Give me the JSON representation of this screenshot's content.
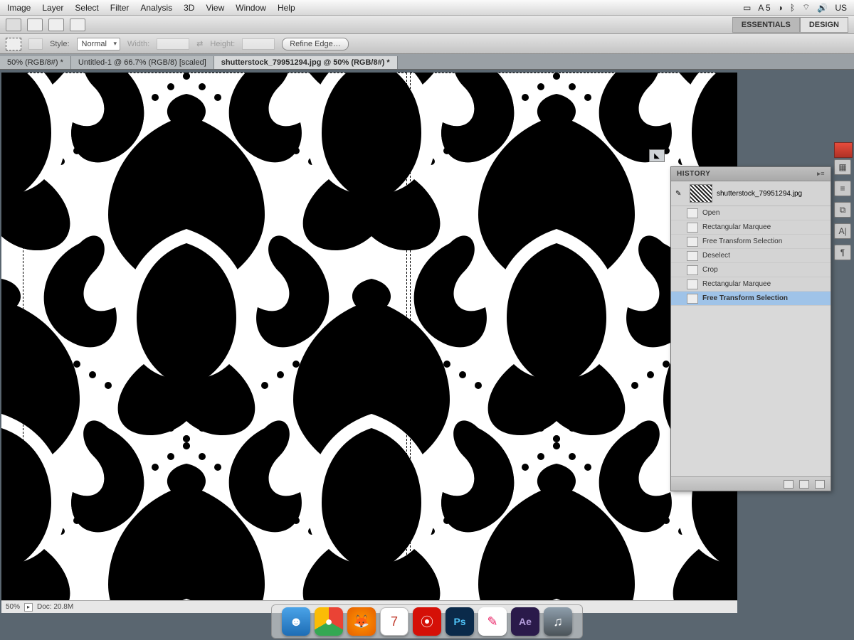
{
  "menubar": {
    "items": [
      "Image",
      "Layer",
      "Select",
      "Filter",
      "Analysis",
      "3D",
      "View",
      "Window",
      "Help"
    ],
    "status": {
      "adobe": "A 5",
      "flag": "US"
    }
  },
  "workspace_tabs": {
    "essentials": "ESSENTIALS",
    "design": "DESIGN"
  },
  "options": {
    "style_label": "Style:",
    "style_value": "Normal",
    "width_label": "Width:",
    "height_label": "Height:",
    "refine_edge": "Refine Edge…"
  },
  "doc_tabs": {
    "tab1": "50% (RGB/8#) *",
    "tab2": "Untitled-1 @ 66.7% (RGB/8) [scaled]",
    "tab3": "shutterstock_79951294.jpg @ 50% (RGB/8#) *"
  },
  "canvas": {
    "status_zoom": "50%",
    "status_docsize": "Doc: 20.8M"
  },
  "history_panel": {
    "title": "HISTORY",
    "snapshot": "shutterstock_79951294.jpg",
    "steps": [
      "Open",
      "Rectangular Marquee",
      "Free Transform Selection",
      "Deselect",
      "Crop",
      "Rectangular Marquee",
      "Free Transform Selection"
    ]
  },
  "dock_icons": [
    "finder",
    "chrome",
    "firefox",
    "calendar",
    "lastfm",
    "photoshop",
    "skitch",
    "aftereffects",
    "itunes"
  ],
  "right_dock": [
    "swatches-icon",
    "adjustments-icon",
    "paragraph-icon",
    "character-icon",
    "layers-icon"
  ]
}
